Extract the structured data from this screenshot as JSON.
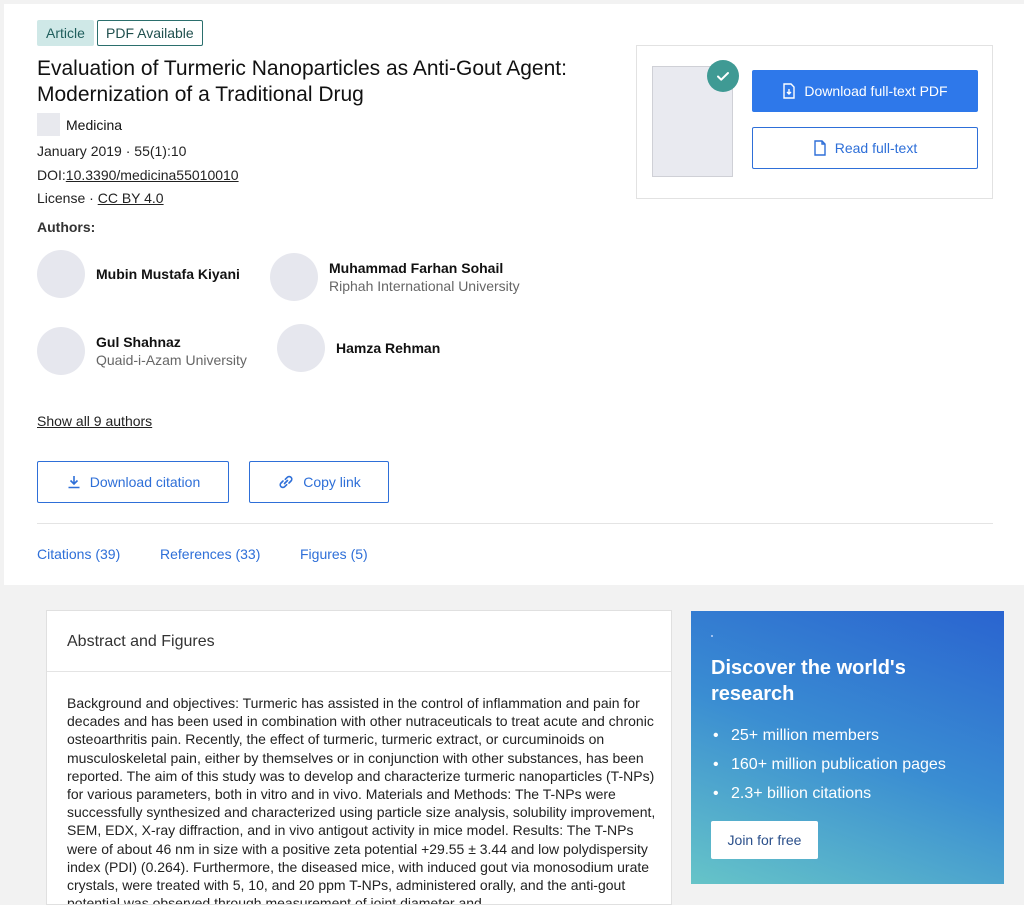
{
  "tags": {
    "article": "Article",
    "pdf": "PDF Available"
  },
  "title": "Evaluation of Turmeric Nanoparticles as Anti-Gout Agent: Modernization of a Traditional Drug",
  "journal": "Medicina",
  "date_line": "January 2019 · 55(1):10",
  "doi": {
    "label": "DOI:",
    "value": "10.3390/medicina55010010"
  },
  "license": {
    "label": "License · ",
    "value": "CC BY 4.0"
  },
  "authors_heading": "Authors:",
  "authors": [
    {
      "name": "Mubin Mustafa Kiyani",
      "affiliation": ""
    },
    {
      "name": "Muhammad Farhan Sohail",
      "affiliation": "Riphah International University"
    },
    {
      "name": "Gul Shahnaz",
      "affiliation": "Quaid-i-Azam University"
    },
    {
      "name": "Hamza Rehman",
      "affiliation": ""
    }
  ],
  "show_all_authors": "Show all 9 authors",
  "actions": {
    "download_citation": "Download citation",
    "copy_link": "Copy link"
  },
  "tabs": [
    {
      "label": "Citations (39)"
    },
    {
      "label": "References (33)"
    },
    {
      "label": "Figures (5)"
    }
  ],
  "download_card": {
    "primary": "Download full-text PDF",
    "secondary": "Read full-text"
  },
  "abstract": {
    "heading": "Abstract and Figures",
    "text": "Background and objectives: Turmeric has assisted in the control of inflammation and pain for decades and has been used in combination with other nutraceuticals to treat acute and chronic osteoarthritis pain. Recently, the effect of turmeric, turmeric extract, or curcuminoids on musculoskeletal pain, either by themselves or in conjunction with other substances, has been reported. The aim of this study was to develop and characterize turmeric nanoparticles (T-NPs) for various parameters, both in vitro and in vivo. Materials and Methods: The T-NPs were successfully synthesized and characterized using particle size analysis, solubility improvement, SEM, EDX, X-ray diffraction, and in vivo antigout activity in mice model. Results: The T-NPs were of about 46 nm in size with a positive zeta potential +29.55 ± 3.44 and low polydispersity index (PDI) (0.264). Furthermore, the diseased mice, with induced gout via monosodium urate crystals, were treated with 5, 10, and 20 ppm T-NPs, administered orally, and the anti-gout potential was observed through measurement of joint diameter and"
  },
  "promo": {
    "heading": "Discover the world's research",
    "items": [
      "25+ million members",
      "160+ million publication pages",
      "2.3+ billion citations"
    ],
    "cta": "Join for free"
  },
  "colors": {
    "accent": "#2e78ea",
    "tag_bg": "#cfe8e7",
    "check": "#3f9a94"
  }
}
